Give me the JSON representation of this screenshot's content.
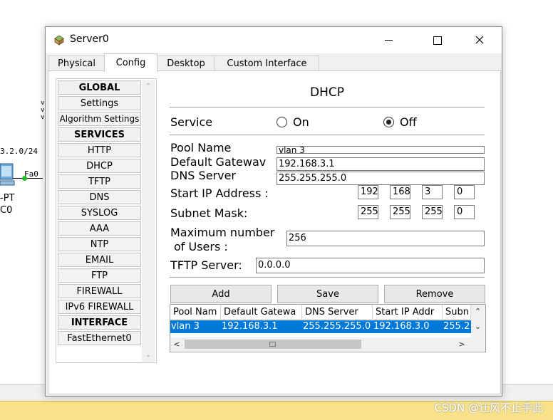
{
  "background": {
    "network_label": "3.2.0/24",
    "interface_label": "Fa0",
    "device_type": "-PT",
    "device_name": "C0",
    "watermark": "CSDN @辻风不止手此"
  },
  "window": {
    "title": "Server0",
    "minimize_icon": "minimize-icon",
    "maximize_icon": "maximize-icon",
    "close_icon": "close-icon"
  },
  "tabs": [
    {
      "label": "Physical",
      "active": false
    },
    {
      "label": "Config",
      "active": true
    },
    {
      "label": "Desktop",
      "active": false
    },
    {
      "label": "Custom Interface",
      "active": false
    }
  ],
  "menu": [
    {
      "label": "GLOBAL",
      "header": true
    },
    {
      "label": "Settings",
      "header": false
    },
    {
      "label": "Algorithm Settings",
      "header": false
    },
    {
      "label": "SERVICES",
      "header": true
    },
    {
      "label": "HTTP",
      "header": false
    },
    {
      "label": "DHCP",
      "header": false
    },
    {
      "label": "TFTP",
      "header": false
    },
    {
      "label": "DNS",
      "header": false
    },
    {
      "label": "SYSLOG",
      "header": false
    },
    {
      "label": "AAA",
      "header": false
    },
    {
      "label": "NTP",
      "header": false
    },
    {
      "label": "EMAIL",
      "header": false
    },
    {
      "label": "FTP",
      "header": false
    },
    {
      "label": "FIREWALL",
      "header": false
    },
    {
      "label": "IPv6 FIREWALL",
      "header": false
    },
    {
      "label": "INTERFACE",
      "header": true
    },
    {
      "label": "FastEthernet0",
      "header": false
    }
  ],
  "dhcp": {
    "heading": "DHCP",
    "service_label": "Service",
    "on_label": "On",
    "off_label": "Off",
    "service_selected": "Off",
    "pool_name_label": "Pool Name",
    "pool_name_value": "vlan 3",
    "default_gateway_label": "Default Gatewav",
    "default_gateway_value": "192.168.3.1",
    "dns_server_label": "DNS Server",
    "dns_server_value": "255.255.255.0",
    "start_ip_label": "Start IP Address :",
    "start_ip": [
      "192",
      "168",
      "3",
      "0"
    ],
    "subnet_mask_label": "Subnet Mask:",
    "subnet_mask": [
      "255",
      "255",
      "255",
      "0"
    ],
    "max_users_label_1": "Maximum number",
    "max_users_label_2": "of Users :",
    "max_users_value": "256",
    "tftp_label": "TFTP Server:",
    "tftp_value": "0.0.0.0",
    "add_label": "Add",
    "save_label": "Save",
    "remove_label": "Remove"
  },
  "pool_table": {
    "headers": [
      "Pool Nam",
      "Default Gatewa",
      "DNS Server",
      "Start IP Addr",
      "Subn"
    ],
    "rows": [
      [
        "vlan 3",
        "192.168.3.1",
        "255.255.255.0",
        "192.168.3.0",
        "255.2"
      ]
    ]
  }
}
